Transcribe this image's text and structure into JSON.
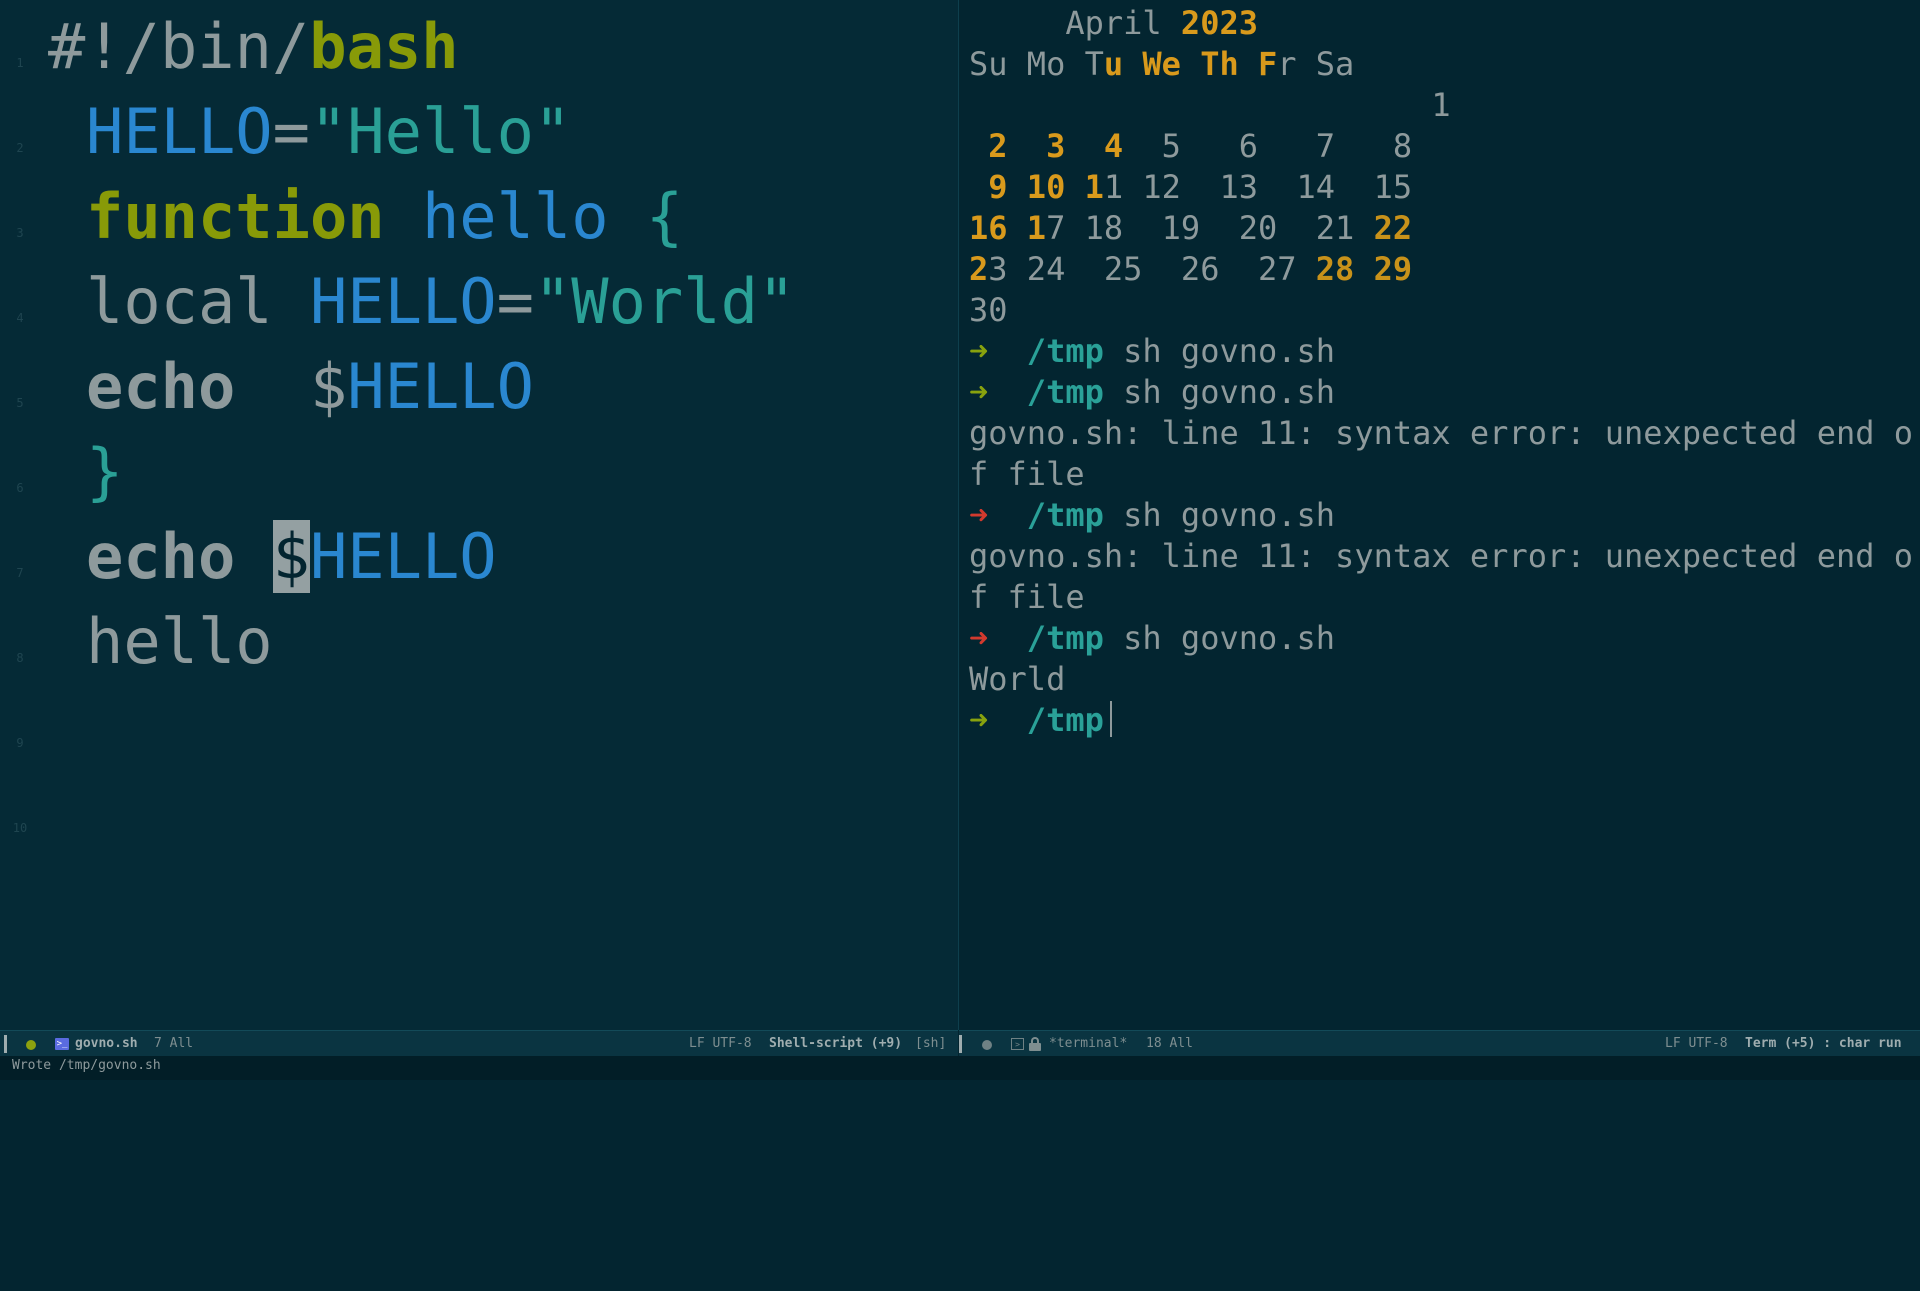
{
  "editor": {
    "line_numbers": [
      "1",
      "2",
      "3",
      "4",
      "5",
      "6",
      "7",
      "8",
      "9",
      "10"
    ],
    "code": {
      "l1_a": "#!/bin/",
      "l1_b": "bash",
      "l2_var": "HELLO",
      "l2_eq": "=",
      "l2_str": "\"Hello\"",
      "l3_kw": "function",
      "l3_name": "hello",
      "l3_brace": "{",
      "l4_local": "local",
      "l4_var": "HELLO",
      "l4_eq": "=",
      "l4_str": "\"World\"",
      "l5_echo": "echo",
      "l5_dollar": "$",
      "l5_var": "HELLO",
      "l6_brace": "}",
      "l7_echo": "echo",
      "l7_dollar": "$",
      "l7_var": "HELLO",
      "l8_call": "hello"
    }
  },
  "terminal": {
    "calendar": {
      "month": "April",
      "year": "2023",
      "days_header": {
        "su": "Su",
        "mo": "Mo",
        "t1": "T",
        "u": "u",
        "we": "We",
        "th": "Th",
        "f": "F",
        "r": "r",
        "sa": "Sa"
      },
      "week1": {
        "d1": "1"
      },
      "week2": {
        "d2": "2",
        "d3": "3",
        "d4": "4",
        "rest": " 5   6   7   8"
      },
      "week3": {
        "d9": "9",
        "d10": "10",
        "d11a": "1",
        "d11b": "1",
        "rest": " 12  13  14  15"
      },
      "week4": {
        "d16": "16",
        "d17a": "1",
        "d17b": "7",
        "mid": " 18  19  20  21 ",
        "d22": "22"
      },
      "week5": {
        "d23a": "2",
        "d23b": "3",
        "mid": " 24  25  26  27 ",
        "d28": "28",
        "d29": "29"
      },
      "week6": {
        "d30": "30"
      }
    },
    "prompt_arrow": "➜",
    "prompt_dir": "/tmp",
    "lines": {
      "cmd1": "sh govno.sh",
      "cmd2": "sh govno.sh",
      "err1a": "govno.sh: line 11: syntax error: unexpected end o",
      "err1b": "f file",
      "cmd3": "sh govno.sh",
      "err2a": "govno.sh: line 11: syntax error: unexpected end o",
      "err2b": "f file",
      "cmd4": "sh govno.sh",
      "out": "World"
    },
    "colors": {
      "prompt_ok": "#88a20e",
      "prompt_err": "#d23a2e",
      "calendar_highlight": "#d99a1c",
      "dir": "#2aa198"
    }
  },
  "modeline_left": {
    "filename": "govno.sh",
    "position": "7 All",
    "encoding": "LF UTF-8",
    "mode": "Shell-script (+9)",
    "submode": "[sh]",
    "icons": [
      "status-dot-icon",
      "shell-file-icon"
    ]
  },
  "modeline_right": {
    "buffer": "*terminal*",
    "position": "18 All",
    "encoding": "LF UTF-8",
    "mode": "Term (+5) : char run",
    "icons": [
      "status-dot-icon",
      "terminal-icon",
      "lock-icon"
    ]
  },
  "echo_area": {
    "message": "Wrote /tmp/govno.sh"
  }
}
